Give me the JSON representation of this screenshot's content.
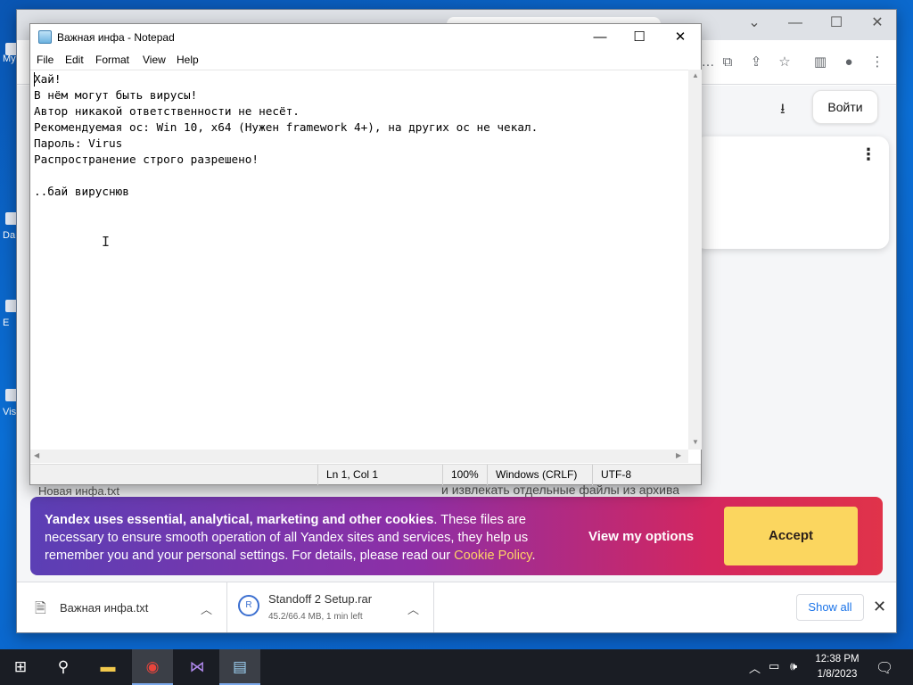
{
  "desktop": {
    "labels": [
      "My",
      "Da",
      "E",
      "Vis"
    ]
  },
  "browser": {
    "toolbar_icons": [
      "translate-icon",
      "share-icon",
      "bookmark-star-icon",
      "side-panel-icon",
      "profile-icon",
      "more-vert-icon"
    ],
    "login_label": "Войти",
    "archive_text": "и извлекать отдельные файлы из архива",
    "partial_file": "Новая инфа.txt"
  },
  "cookie_banner": {
    "text_bold": "Yandex uses essential, analytical, marketing and other cookies",
    "text_rest": ". These files are necessary to ensure smooth operation of all Yandex sites and services, they help us remember you and your personal settings. For details, please read our ",
    "link": "Cookie Policy",
    "period": ".",
    "options_label": "View my options",
    "accept_label": "Accept",
    "accent": "#fbd65f"
  },
  "downloads": {
    "items": [
      {
        "name": "Важная инфа.txt",
        "icon": "text-file-icon"
      },
      {
        "name": "Standoff 2 Setup.rar",
        "progress": "45.2/66.4 MB, 1 min left",
        "icon": "winrar-icon"
      }
    ],
    "show_all_label": "Show all"
  },
  "notepad": {
    "title": "Важная инфа - Notepad",
    "menu": [
      "File",
      "Edit",
      "Format",
      "View",
      "Help"
    ],
    "content": "Хай!\nВ нём могут быть вирусы!\nАвтор никакой ответственности не несёт.\nРекомендуемая ос: Win 10, x64 (Нужен framework 4+), на других ос не чекал.\nПароль: Virus\nРаспространение строго разрешено!\n\n..бай вируснюв",
    "status": {
      "position": "Ln 1, Col 1",
      "zoom": "100%",
      "line_ending": "Windows (CRLF)",
      "encoding": "UTF-8"
    }
  },
  "taskbar": {
    "apps": [
      "start-icon",
      "search-icon",
      "file-explorer-icon",
      "chrome-icon",
      "visual-studio-icon",
      "notepad-icon"
    ],
    "time": "12:38 PM",
    "date": "1/8/2023"
  }
}
